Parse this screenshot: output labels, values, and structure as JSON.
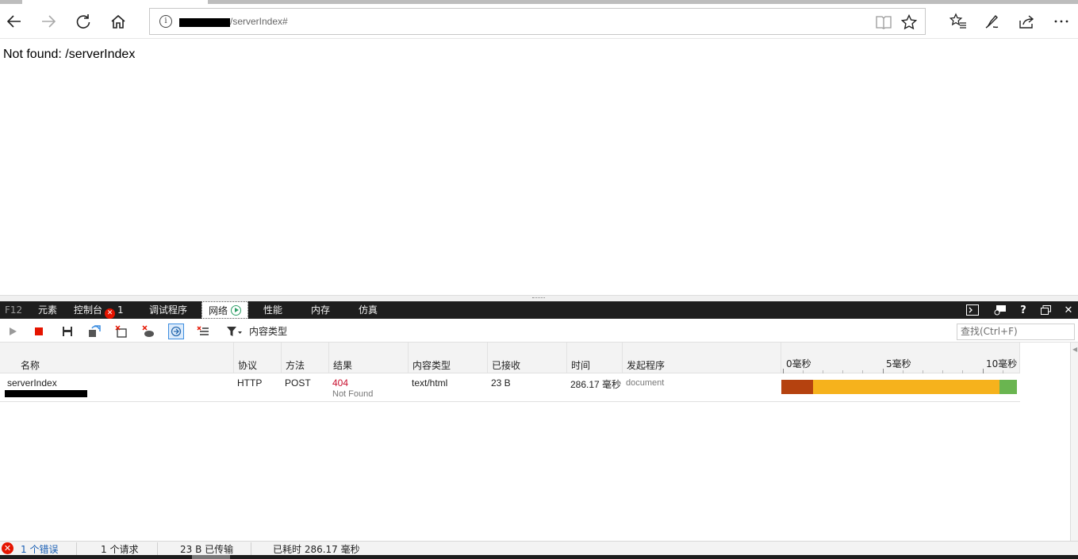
{
  "browser": {
    "url_visible": "/serverIndex#",
    "icons": [
      "back-icon",
      "forward-icon",
      "refresh-icon",
      "home-icon",
      "info-icon",
      "reading-view-icon",
      "favorite-star-icon",
      "favorites-hub-icon",
      "pen-icon",
      "share-icon",
      "more-icon"
    ]
  },
  "page": {
    "message": "Not found: /serverIndex"
  },
  "devtools": {
    "tabs": {
      "f12": "F12",
      "elements": "元素",
      "console": "控制台",
      "console_errors": "1",
      "debugger": "调试程序",
      "network": "网络",
      "performance": "性能",
      "memory": "内存",
      "emulation": "仿真"
    },
    "toolbar": {
      "filter_label": "内容类型",
      "search_placeholder": "查找(Ctrl+F)"
    },
    "columns": {
      "name": "名称",
      "protocol": "协议",
      "method": "方法",
      "result": "结果",
      "content_type": "内容类型",
      "received": "已接收",
      "time": "时间",
      "initiator": "发起程序"
    },
    "timeline": {
      "labels": [
        "0毫秒",
        "5毫秒",
        "10毫秒"
      ]
    },
    "requests": [
      {
        "name": "serverIndex",
        "protocol": "HTTP",
        "method": "POST",
        "status": "404",
        "status_text": "Not Found",
        "content_type": "text/html",
        "received": "23 B",
        "time": "286.17 毫秒",
        "initiator": "document",
        "timing_segments": [
          {
            "phase": "wait",
            "fraction": 0.135,
            "color": "#b5420f"
          },
          {
            "phase": "transfer",
            "fraction": 0.79,
            "color": "#f6b21c"
          },
          {
            "phase": "end",
            "fraction": 0.075,
            "color": "#6ab550"
          }
        ]
      }
    ],
    "status": {
      "errors": "1 个错误",
      "requests": "1 个请求",
      "transferred": "23 B 已传输",
      "elapsed": "已耗时 286.17 毫秒"
    }
  }
}
